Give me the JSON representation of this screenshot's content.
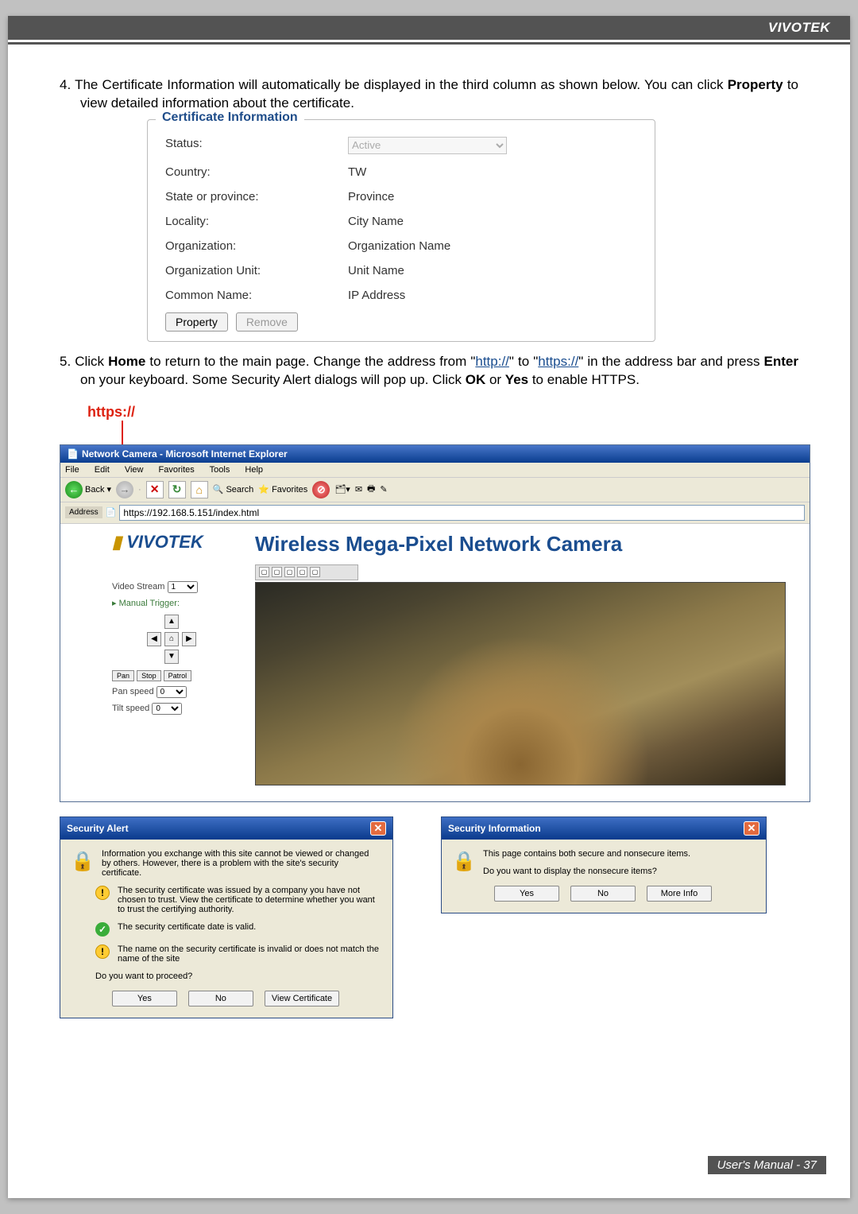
{
  "brand": "VIVOTEK",
  "step4_text_a": "4. The Certificate Information will automatically be displayed in the third column as shown below. You can click ",
  "step4_text_b": " to view detailed information about the certificate.",
  "step4_bold": "Property",
  "cert": {
    "legend": "Certificate Information",
    "status_lbl": "Status:",
    "status_val": "Active",
    "country_lbl": "Country:",
    "country_val": "TW",
    "state_lbl": "State or province:",
    "state_val": "Province",
    "locality_lbl": "Locality:",
    "locality_val": "City Name",
    "org_lbl": "Organization:",
    "org_val": "Organization Name",
    "unit_lbl": "Organization Unit:",
    "unit_val": "Unit Name",
    "cn_lbl": "Common Name:",
    "cn_val": "IP Address",
    "property_btn": "Property",
    "remove_btn": "Remove"
  },
  "step5": {
    "a": "5. Click ",
    "home": "Home",
    "b": " to return to the main page. Change the address from \"",
    "http": "http://",
    "c": "\" to \"",
    "https": "https://",
    "d": "\" in the address bar and press ",
    "enter": "Enter",
    "e": " on your keyboard. Some Security Alert dialogs will pop up. Click ",
    "ok": "OK",
    "or": " or ",
    "yes": "Yes",
    "f": " to enable HTTPS."
  },
  "https_label": "https://",
  "ie": {
    "title": "Network Camera - Microsoft Internet Explorer",
    "menu": {
      "file": "File",
      "edit": "Edit",
      "view": "View",
      "favorites": "Favorites",
      "tools": "Tools",
      "help": "Help"
    },
    "toolbar": {
      "back": "Back",
      "search": "Search",
      "favorites": "Favorites"
    },
    "address_lbl": "Address",
    "address_val": "https://192.168.5.151/index.html",
    "logo": "VIVOTEK",
    "page_title": "Wireless Mega-Pixel Network Camera",
    "video_stream_lbl": "Video Stream",
    "video_stream_val": "1",
    "manual_trigger": "Manual Trigger:",
    "pan_btn": "Pan",
    "stop_btn": "Stop",
    "patrol_btn": "Patrol",
    "pan_speed_lbl": "Pan speed",
    "pan_speed_val": "0",
    "tilt_speed_lbl": "Tilt speed",
    "tilt_speed_val": "0"
  },
  "alert": {
    "title": "Security Alert",
    "intro": "Information you exchange with this site cannot be viewed or changed by others. However, there is a problem with the site's security certificate.",
    "line1": "The security certificate was issued by a company you have not chosen to trust. View the certificate to determine whether you want to trust the certifying authority.",
    "line2": "The security certificate date is valid.",
    "line3": "The name on the security certificate is invalid or does not match the name of the site",
    "proceed": "Do you want to proceed?",
    "yes": "Yes",
    "no": "No",
    "view": "View Certificate"
  },
  "secinfo": {
    "title": "Security Information",
    "line1": "This page contains both secure and nonsecure items.",
    "line2": "Do you want to display the nonsecure items?",
    "yes": "Yes",
    "no": "No",
    "more": "More Info"
  },
  "footer": "User's Manual - 37"
}
